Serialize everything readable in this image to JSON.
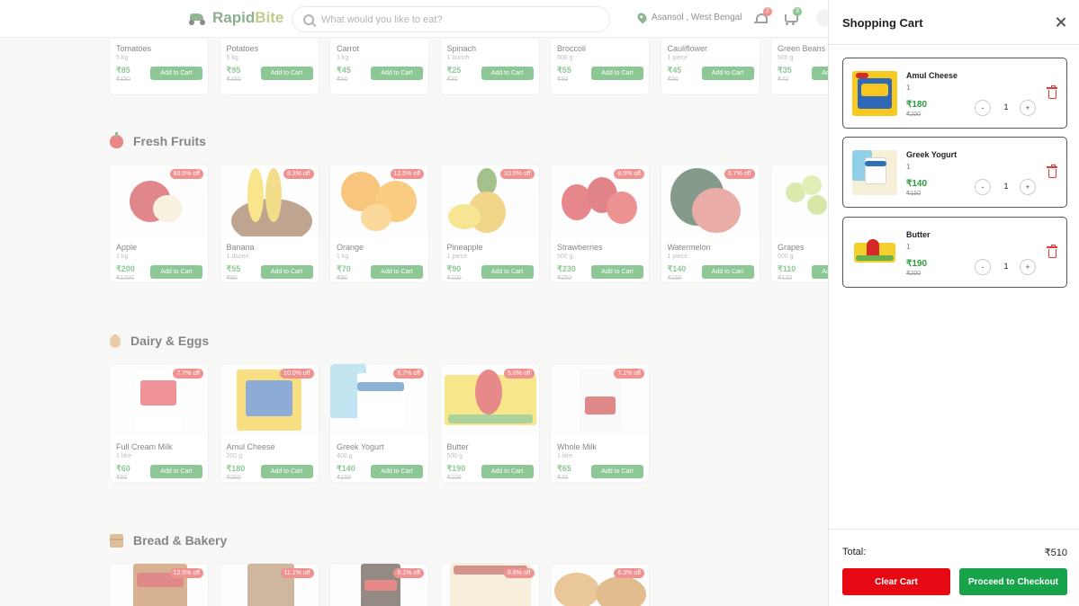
{
  "header": {
    "brand_a": "Rapid",
    "brand_b": "Bite",
    "search_placeholder": "What would you like to eat?",
    "location": "Asansol , West Bengal",
    "notifications_count": "2",
    "cart_count": "3"
  },
  "vegetables": [
    {
      "name": "Tomatoes",
      "qty": "5 kg",
      "price": "₹85",
      "mrp": "₹150"
    },
    {
      "name": "Potatoes",
      "qty": "5 kg",
      "price": "₹95",
      "mrp": "₹150"
    },
    {
      "name": "Carrot",
      "qty": "1 kg",
      "price": "₹45",
      "mrp": "₹50"
    },
    {
      "name": "Spinach",
      "qty": "1 bunch",
      "price": "₹25",
      "mrp": "₹30"
    },
    {
      "name": "Broccoli",
      "qty": "500 g",
      "price": "₹55",
      "mrp": "₹60"
    },
    {
      "name": "Cauliflower",
      "qty": "1 piece",
      "price": "₹45",
      "mrp": "₹50"
    },
    {
      "name": "Green Beans",
      "qty": "500 g",
      "price": "₹35",
      "mrp": "₹40"
    }
  ],
  "sections": {
    "fruits": "Fresh Fruits",
    "dairy": "Dairy & Eggs",
    "bakery": "Bread & Bakery"
  },
  "add_label": "Add to Cart",
  "fruits": [
    {
      "name": "Apple",
      "qty": "1 kg",
      "price": "₹200",
      "mrp": "₹1000",
      "off": "80.0% off"
    },
    {
      "name": "Banana",
      "qty": "1 dozen",
      "price": "₹55",
      "mrp": "₹60",
      "off": "8.3% off"
    },
    {
      "name": "Orange",
      "qty": "1 kg",
      "price": "₹70",
      "mrp": "₹80",
      "off": "12.5% off"
    },
    {
      "name": "Pineapple",
      "qty": "1 piece",
      "price": "₹90",
      "mrp": "₹100",
      "off": "10.0% off"
    },
    {
      "name": "Strawberries",
      "qty": "500 g",
      "price": "₹230",
      "mrp": "₹250",
      "off": "8.0% off"
    },
    {
      "name": "Watermelon",
      "qty": "1 piece",
      "price": "₹140",
      "mrp": "₹150",
      "off": "6.7% off"
    },
    {
      "name": "Grapes",
      "qty": "500 g",
      "price": "₹110",
      "mrp": "₹120",
      "off": ""
    }
  ],
  "dairy": [
    {
      "name": "Full Cream Milk",
      "qty": "1 litre",
      "price": "₹60",
      "mrp": "₹65",
      "off": "7.7% off"
    },
    {
      "name": "Amul Cheese",
      "qty": "200 g",
      "price": "₹180",
      "mrp": "₹200",
      "off": "10.0% off"
    },
    {
      "name": "Greek Yogurt",
      "qty": "400 g",
      "price": "₹140",
      "mrp": "₹150",
      "off": "6.7% off"
    },
    {
      "name": "Butter",
      "qty": "500 g",
      "price": "₹190",
      "mrp": "₹200",
      "off": "5.0% off"
    },
    {
      "name": "Whole Milk",
      "qty": "1 litre",
      "price": "₹65",
      "mrp": "₹70",
      "off": "7.1% off"
    }
  ],
  "bakery": [
    {
      "off": "12.5% off"
    },
    {
      "off": "11.1% off"
    },
    {
      "off": "9.1% off"
    },
    {
      "off": "8.6% off"
    },
    {
      "off": "6.3% off"
    }
  ],
  "cart": {
    "title": "Shopping Cart",
    "items": [
      {
        "name": "Amul Cheese",
        "qty": "1",
        "price": "₹180",
        "mrp": "₹200",
        "count": "1"
      },
      {
        "name": "Greek Yogurt",
        "qty": "1",
        "price": "₹140",
        "mrp": "₹150",
        "count": "1"
      },
      {
        "name": "Butter",
        "qty": "1",
        "price": "₹190",
        "mrp": "₹200",
        "count": "1"
      }
    ],
    "total_label": "Total:",
    "total_value": "₹510",
    "clear_label": "Clear Cart",
    "checkout_label": "Proceed to Checkout",
    "minus": "-",
    "plus": "+"
  },
  "colors": {
    "accent_green": "#2e9a3e",
    "discount_red": "#e53935",
    "clear_red": "#e50914",
    "checkout_green": "#18a34a"
  }
}
